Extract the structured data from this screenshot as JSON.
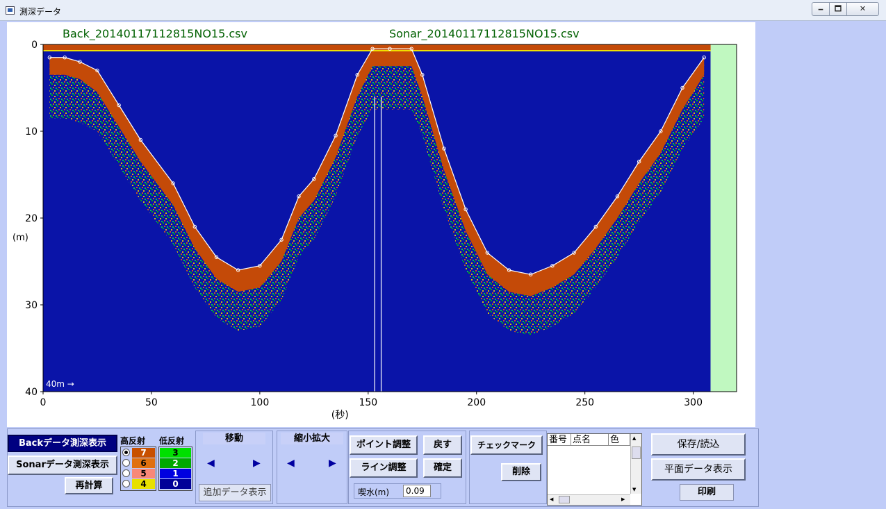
{
  "window": {
    "title": "測深データ",
    "minimize": "🗕",
    "maximize": "🗖",
    "close": "✕"
  },
  "chart": {
    "back_file": "Back_20140117112815NO15.csv",
    "sonar_file": "Sonar_20140117112815NO15.csv",
    "y_unit": "(m)",
    "x_unit": "(秒)",
    "scale_note": "40m →",
    "colors": {
      "background": "#0a14a8",
      "band": "#c44a08",
      "side_strip": "#c0f8c0"
    }
  },
  "chart_data": {
    "type": "heatmap",
    "xlabel": "(秒)",
    "ylabel": "(m)",
    "xlim": [
      0,
      320
    ],
    "ylim": [
      40,
      0
    ],
    "x_ticks": [
      0,
      50,
      100,
      150,
      200,
      250,
      300
    ],
    "y_ticks": [
      0,
      10,
      20,
      30,
      40
    ],
    "bottom_profile": {
      "x": [
        3,
        10,
        17,
        25,
        35,
        45,
        60,
        70,
        80,
        90,
        100,
        110,
        118,
        125,
        135,
        145,
        152,
        160,
        170,
        175,
        185,
        195,
        205,
        215,
        225,
        235,
        245,
        255,
        265,
        275,
        285,
        295,
        305
      ],
      "depth": [
        1.5,
        1.5,
        2.0,
        3.0,
        7.0,
        11.0,
        16.0,
        21.0,
        24.5,
        26.0,
        25.5,
        22.5,
        17.5,
        15.5,
        10.5,
        3.5,
        0.5,
        0.5,
        0.5,
        3.5,
        12.0,
        19.0,
        24.0,
        26.0,
        26.5,
        25.5,
        24.0,
        21.0,
        17.5,
        13.5,
        10.0,
        5.0,
        1.5
      ]
    }
  },
  "controls": {
    "back_display": "Backデータ測深表示",
    "sonar_display": "Sonarデータ測深表示",
    "recalc": "再計算",
    "legend": {
      "high_label": "高反射",
      "low_label": "低反射",
      "high": [
        {
          "value": "7",
          "color": "#c85000",
          "text_color": "#ffffff",
          "checked": true
        },
        {
          "value": "6",
          "color": "#e07010",
          "text_color": "#000000",
          "checked": false
        },
        {
          "value": "5",
          "color": "#f88878",
          "text_color": "#000000",
          "checked": false
        },
        {
          "value": "4",
          "color": "#e8e000",
          "text_color": "#000000",
          "checked": false
        }
      ],
      "low": [
        {
          "value": "3",
          "color": "#00e000",
          "text_color": "#000000"
        },
        {
          "value": "2",
          "color": "#00a800",
          "text_color": "#ffffff"
        },
        {
          "value": "1",
          "color": "#0000e0",
          "text_color": "#ffffff"
        },
        {
          "value": "0",
          "color": "#000098",
          "text_color": "#ffffff"
        }
      ]
    },
    "move": {
      "title": "移動",
      "left": "◀",
      "right": "▶"
    },
    "add_data": "追加データ表示",
    "zoom": {
      "title": "縮小拡大",
      "left": "◀",
      "right": "▶"
    },
    "point_adjust": "ポイント調整",
    "line_adjust": "ライン調整",
    "back": "戻す",
    "confirm": "確定",
    "draft_label": "喫水(m)",
    "draft_value": "0.09",
    "check_mark": "チェックマーク",
    "delete": "削除",
    "table_headers": [
      "番号",
      "点名",
      "色"
    ],
    "save_load": "保存/読込",
    "plane_display": "平面データ表示",
    "print": "印刷"
  }
}
